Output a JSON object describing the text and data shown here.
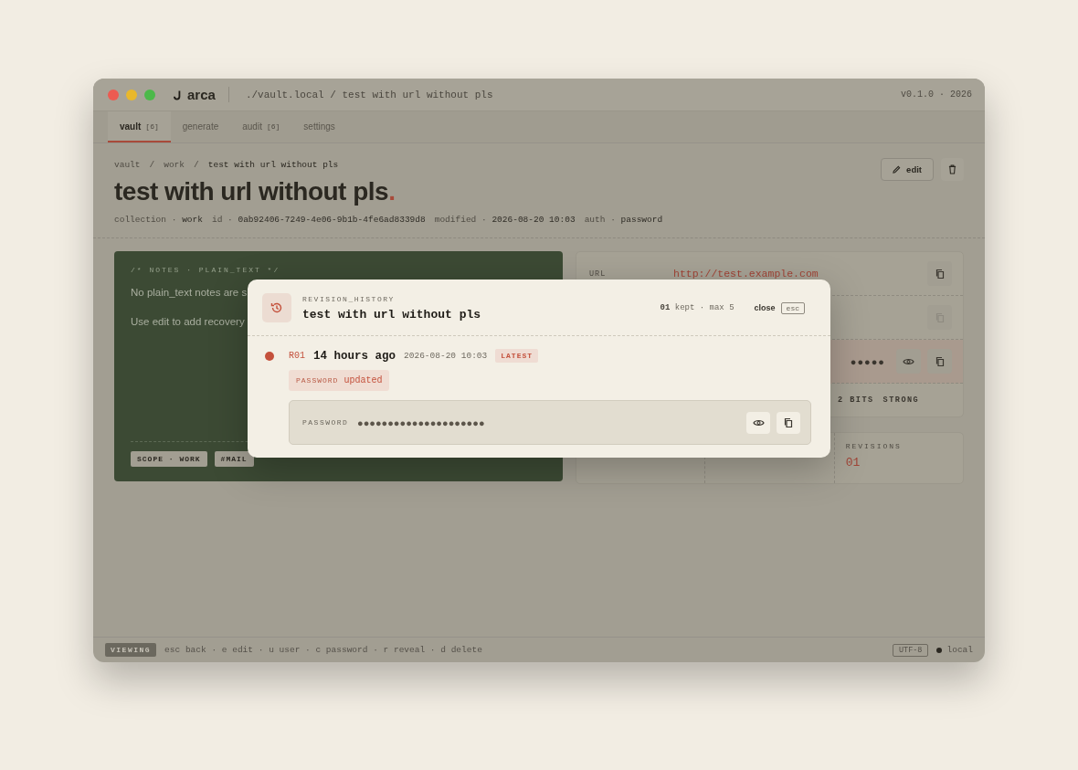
{
  "window": {
    "app_name": "arca",
    "path": "./vault.local / test with url without pls",
    "version": "v0.1.0 · 2026"
  },
  "tabs": [
    {
      "label": "vault",
      "count": "[6]",
      "selected": true
    },
    {
      "label": "generate",
      "selected": false
    },
    {
      "label": "audit",
      "count": "[6]",
      "selected": false
    },
    {
      "label": "settings",
      "selected": false
    }
  ],
  "breadcrumb": {
    "items": [
      "vault",
      "work",
      "test with url without pls"
    ],
    "separator": "/"
  },
  "title": "test with url without pls",
  "title_mark": ".",
  "meta": [
    {
      "label": "collection",
      "value": "work"
    },
    {
      "label": "id",
      "value": "0ab92406-7249-4e06-9b1b-4fe6ad8339d8"
    },
    {
      "label": "modified",
      "value": "2026-08-20 10:03"
    },
    {
      "label": "auth",
      "value": "password"
    }
  ],
  "meta_separator": "·",
  "actions": {
    "edit": "edit"
  },
  "notes": {
    "header": "/* NOTES · PLAIN_TEXT */",
    "lines": [
      "No plain_text notes are s",
      "Use edit to add recovery"
    ],
    "tags": [
      "SCOPE · WORK",
      "#MAIL"
    ]
  },
  "fields": [
    {
      "kind": "link",
      "label": "URL",
      "value": "http://test.example.com"
    },
    {
      "kind": "covered"
    },
    {
      "kind": "secret",
      "value": "●●●●●"
    }
  ],
  "strength": [
    "2 BITS",
    "STRONG"
  ],
  "stats": [
    {
      "kind": "covered"
    },
    {
      "kind": "covered"
    },
    {
      "kind": "count",
      "label": "REVISIONS",
      "value": "01"
    }
  ],
  "modal": {
    "label": "REVISION_HISTORY",
    "title": "test with url without pls",
    "kept": "01",
    "kept_text": "kept · max 5",
    "close": "close",
    "close_key": "esc",
    "revisions": [
      {
        "id": "R01",
        "when": "14 hours ago",
        "date": "2026-08-20 10:03",
        "badge": "LATEST",
        "changes": [
          {
            "field": "PASSWORD",
            "action": "updated"
          }
        ],
        "secret": {
          "label": "PASSWORD",
          "value": "●●●●●●●●●●●●●●●●●●●●●"
        }
      }
    ]
  },
  "status_bar": {
    "mode": "VIEWING",
    "hints": "esc back · e edit · u user · c password · r reveal · d delete",
    "encoding": "UTF-8",
    "connection": "local"
  }
}
